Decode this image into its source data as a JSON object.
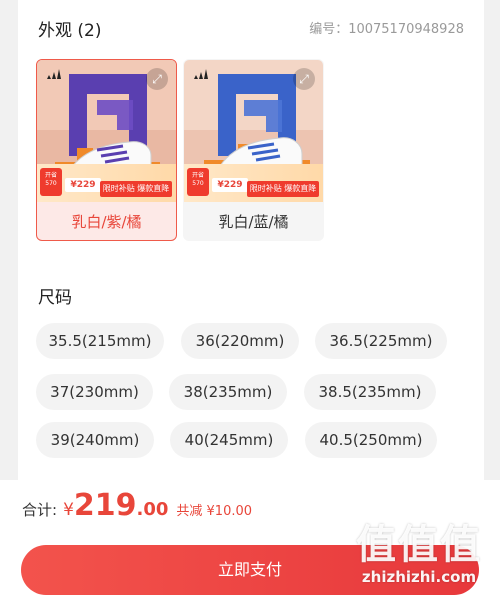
{
  "appearance": {
    "title": "外观 (2)",
    "code": "编号：10075170948928",
    "variants": [
      {
        "label": "乳白/紫/橘",
        "selected": true,
        "promo_tag": "开省570",
        "price": "¥229",
        "hot": "限时补贴 爆款直降",
        "frame_color": "#5a3fb0"
      },
      {
        "label": "乳白/蓝/橘",
        "selected": false,
        "promo_tag": "开省570",
        "price": "¥229",
        "hot": "限时补贴 爆款直降",
        "frame_color": "#3a63c9"
      }
    ]
  },
  "size": {
    "title": "尺码",
    "options": [
      "35.5(215mm)",
      "36(220mm)",
      "36.5(225mm)",
      "37(230mm)",
      "38(235mm)",
      "38.5(235mm)",
      "39(240mm)",
      "40(245mm)",
      "40.5(250mm)"
    ]
  },
  "footer": {
    "total_label": "合计:",
    "currency": "¥",
    "total_int": "219",
    "total_dec": ".00",
    "saving": "共减 ¥10.00",
    "pay_label": "立即支付"
  },
  "watermark": {
    "big": "值值值",
    "small": "zhizhizhi.com"
  },
  "colors": {
    "accent": "#e8463a",
    "chip_bg": "#f3f3f3"
  }
}
